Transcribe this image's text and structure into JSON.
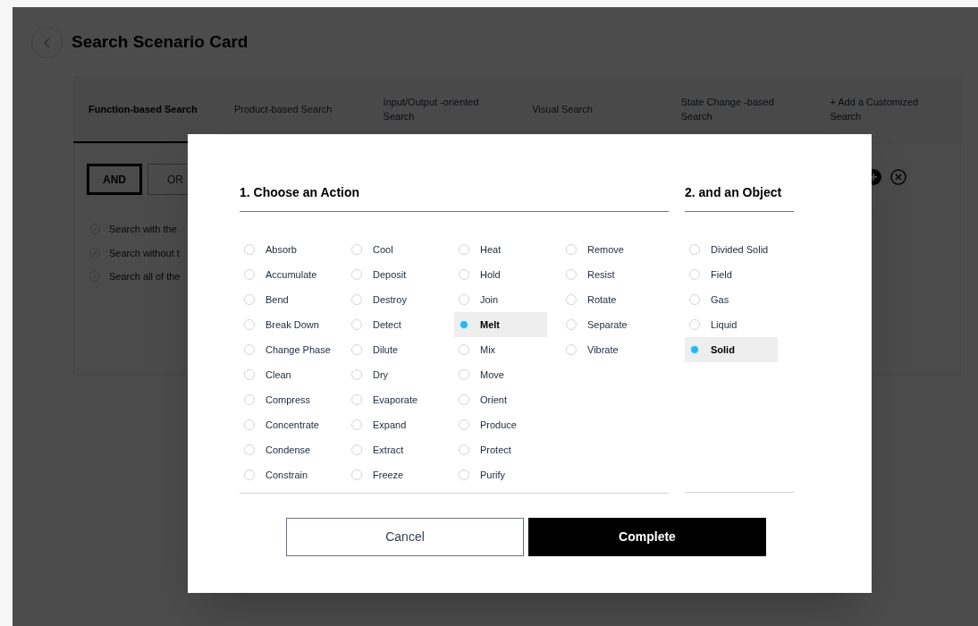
{
  "page": {
    "title": "Search Scenario Card"
  },
  "tabs": [
    {
      "label": "Function-based Search",
      "selected": true
    },
    {
      "label": "Product-based Search",
      "selected": false
    },
    {
      "label": "Input/Output -oriented Search",
      "selected": false
    },
    {
      "label": "Visual Search",
      "selected": false
    },
    {
      "label": "State Change -based Search",
      "selected": false
    },
    {
      "label": "+ Add a Customized Search",
      "selected": false
    }
  ],
  "logic": [
    {
      "label": "AND",
      "selected": true
    },
    {
      "label": "OR",
      "selected": false
    }
  ],
  "options": [
    "Search with the",
    "Search without t",
    "Search all of the"
  ],
  "dialog": {
    "action_title": "1. Choose an Action",
    "object_title": "2. and an Object",
    "actions": [
      {
        "label": "Absorb",
        "selected": false
      },
      {
        "label": "Accumulate",
        "selected": false
      },
      {
        "label": "Bend",
        "selected": false
      },
      {
        "label": "Break Down",
        "selected": false
      },
      {
        "label": "Change Phase",
        "selected": false
      },
      {
        "label": "Clean",
        "selected": false
      },
      {
        "label": "Compress",
        "selected": false
      },
      {
        "label": "Concentrate",
        "selected": false
      },
      {
        "label": "Condense",
        "selected": false
      },
      {
        "label": "Constrain",
        "selected": false
      },
      {
        "label": "Cool",
        "selected": false
      },
      {
        "label": "Deposit",
        "selected": false
      },
      {
        "label": "Destroy",
        "selected": false
      },
      {
        "label": "Detect",
        "selected": false
      },
      {
        "label": "Dilute",
        "selected": false
      },
      {
        "label": "Dry",
        "selected": false
      },
      {
        "label": "Evaporate",
        "selected": false
      },
      {
        "label": "Expand",
        "selected": false
      },
      {
        "label": "Extract",
        "selected": false
      },
      {
        "label": "Freeze",
        "selected": false
      },
      {
        "label": "Heat",
        "selected": false
      },
      {
        "label": "Hold",
        "selected": false
      },
      {
        "label": "Join",
        "selected": false
      },
      {
        "label": "Melt",
        "selected": true
      },
      {
        "label": "Mix",
        "selected": false
      },
      {
        "label": "Move",
        "selected": false
      },
      {
        "label": "Orient",
        "selected": false
      },
      {
        "label": "Produce",
        "selected": false
      },
      {
        "label": "Protect",
        "selected": false
      },
      {
        "label": "Purify",
        "selected": false
      },
      {
        "label": "Remove",
        "selected": false
      },
      {
        "label": "Resist",
        "selected": false
      },
      {
        "label": "Rotate",
        "selected": false
      },
      {
        "label": "Separate",
        "selected": false
      },
      {
        "label": "Vibrate",
        "selected": false
      }
    ],
    "objects": [
      {
        "label": "Divided Solid",
        "selected": false
      },
      {
        "label": "Field",
        "selected": false
      },
      {
        "label": "Gas",
        "selected": false
      },
      {
        "label": "Liquid",
        "selected": false
      },
      {
        "label": "Solid",
        "selected": true
      }
    ],
    "buttons": {
      "cancel": "Cancel",
      "complete": "Complete"
    }
  }
}
